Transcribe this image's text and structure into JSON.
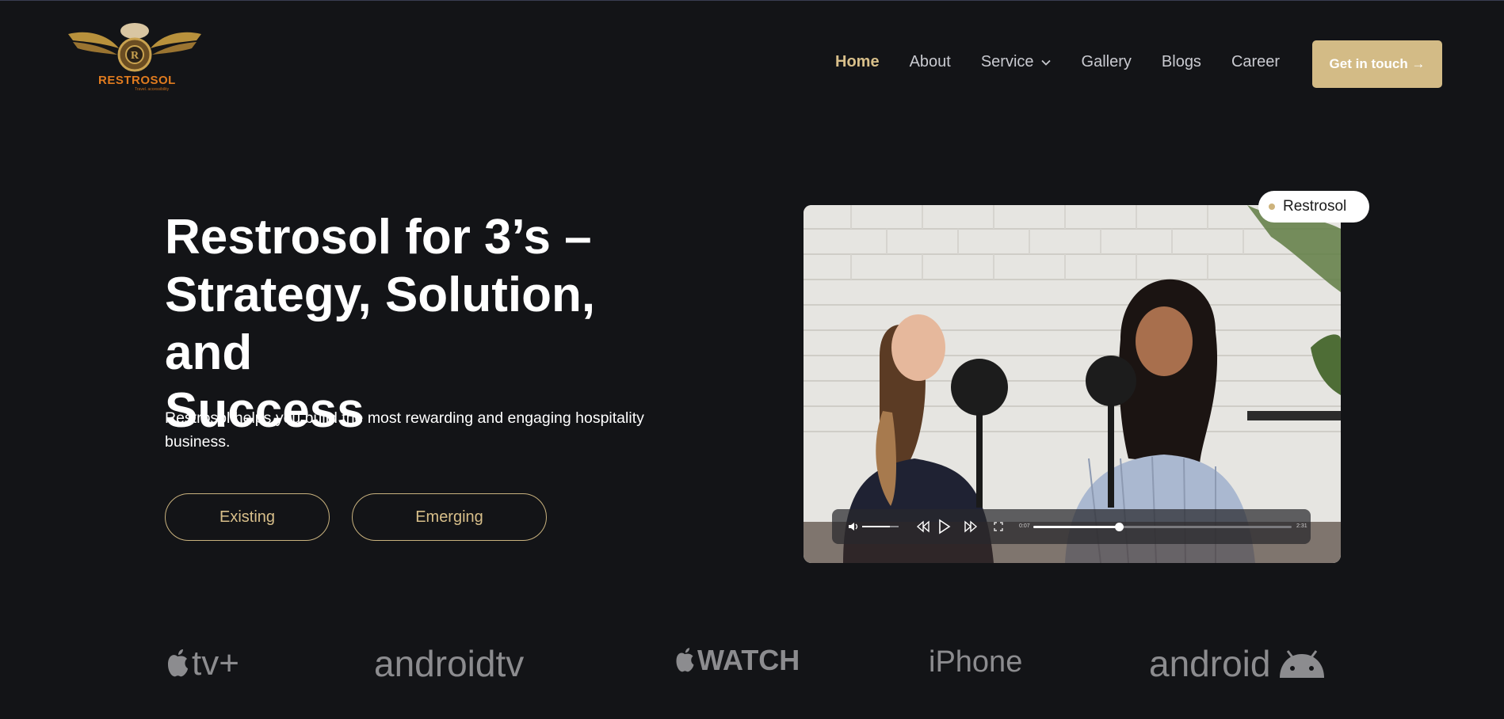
{
  "header": {
    "logo_text": "RESTROSOL",
    "logo_tagline": "Travel. accessibility",
    "nav": [
      {
        "label": "Home",
        "active": true
      },
      {
        "label": "About"
      },
      {
        "label": "Service",
        "has_dropdown": true
      },
      {
        "label": "Gallery"
      },
      {
        "label": "Blogs"
      },
      {
        "label": "Career"
      }
    ],
    "cta_label": "Get in touch →"
  },
  "hero": {
    "title_line1": "Restrosol for 3’s –",
    "title_line2": "Strategy, Solution, and",
    "title_line3": "Success",
    "subtitle": "Restrosol helps you build the most rewarding and engaging hospitality business.",
    "buttons": {
      "existing": "Existing",
      "emerging": "Emerging"
    }
  },
  "video": {
    "badge": "Restrosol",
    "time_current": "0:07",
    "time_total": "2:31",
    "progress": 0.33,
    "volume": 0.75
  },
  "platforms": {
    "appletv": "tv+",
    "androidtv_a": "android",
    "androidtv_b": "tv",
    "watch": "WATCH",
    "iphone": "iPhone",
    "android": "android"
  },
  "colors": {
    "background": "#131417",
    "accent": "#d3bb86",
    "muted_logo": "#8c8c8f"
  }
}
